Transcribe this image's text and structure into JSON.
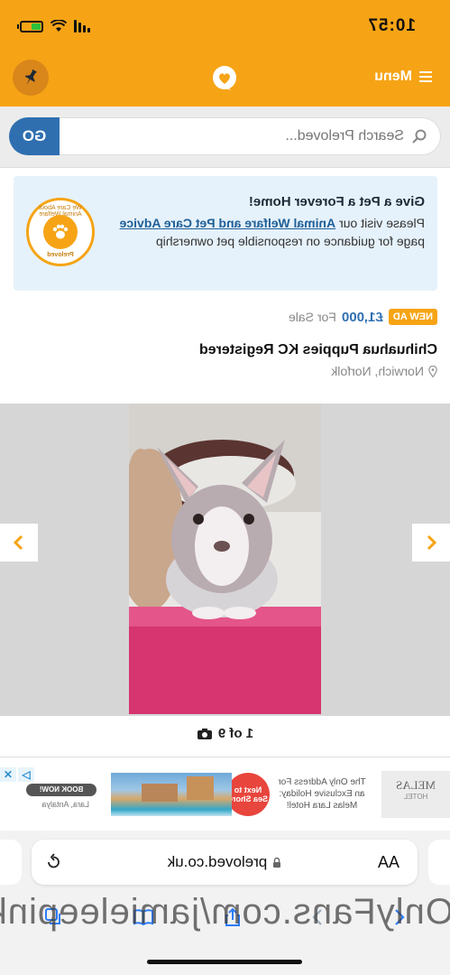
{
  "status_bar": {
    "time": "10:57"
  },
  "header": {
    "menu_label": "Menu"
  },
  "search": {
    "placeholder": "Search Preloved...",
    "go_label": "GO"
  },
  "banner": {
    "title": "Give a Pet a Forever Home!",
    "text_before": "Please visit our ",
    "link_label": "Animal Welfare and Pet Care Advice",
    "text_after": " page for guidance on responsible pet ownership",
    "badge_text_top": "We Care About Animal Welfare",
    "badge_text_bottom": "Preloved"
  },
  "listing": {
    "badge": "NEW AD",
    "price": "£1,000",
    "price_suffix": "For Sale",
    "title": "Chihuahua Puppies KC Registered",
    "location": "Norwich, Norfolk"
  },
  "gallery": {
    "counter": "1 of 9"
  },
  "ad": {
    "brand": "MELAS",
    "brand_sub": "HOTEL",
    "copy": "The Only Address For an Exclusive Holiday: Melas Lara Hotel!",
    "sticker": "Next to Sea Shore",
    "book_label": "BOOK NOW!",
    "place": "Lara, Antalya"
  },
  "browser": {
    "aa_label": "AA",
    "url": "preloved.co.uk"
  },
  "overlay": {
    "text": "OnlyFans.com/jamieleepinks"
  },
  "colors": {
    "brand_orange": "#f6a416",
    "brand_blue": "#2f6fb0"
  }
}
